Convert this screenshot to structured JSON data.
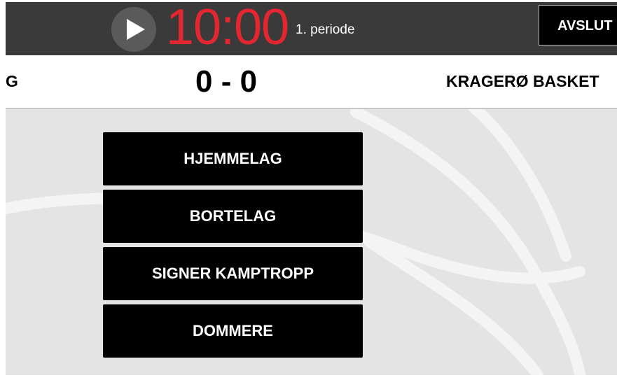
{
  "header": {
    "timer": "10:00",
    "period": "1. periode",
    "end_button_label": "AVSLUT",
    "play_icon": "play-icon"
  },
  "scoreboard": {
    "home_team": "G",
    "score": "0 - 0",
    "away_team": "KRAGERØ BASKET"
  },
  "menu": {
    "items": [
      {
        "label": "HJEMMELAG"
      },
      {
        "label": "BORTELAG"
      },
      {
        "label": "SIGNER KAMPTROPP"
      },
      {
        "label": "DOMMERE"
      }
    ]
  },
  "colors": {
    "timer": "#e3262f",
    "topbar": "#3b3a3a",
    "court": "#e4e4e4",
    "button": "#000000"
  }
}
